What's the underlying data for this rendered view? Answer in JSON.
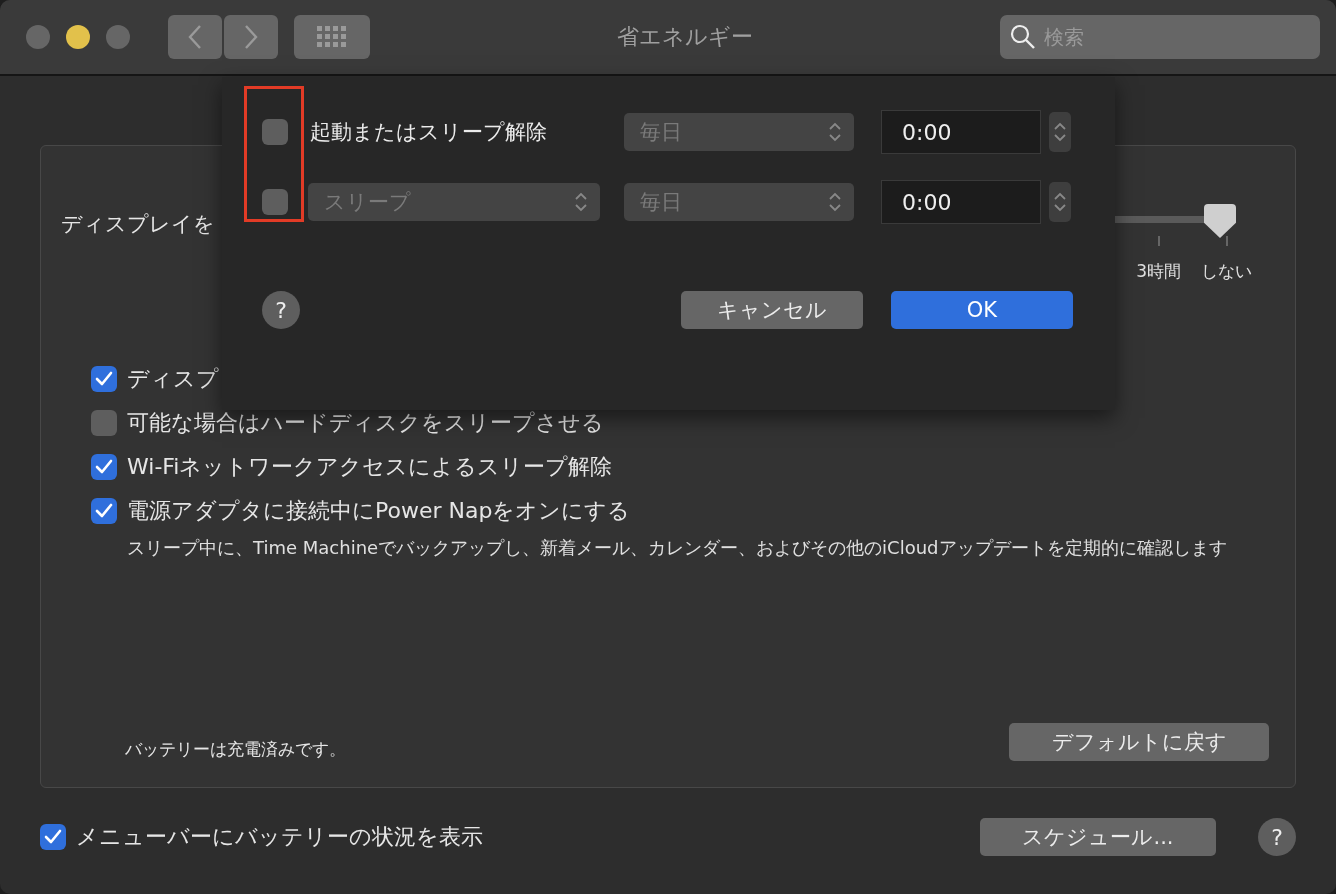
{
  "window": {
    "title": "省エネルギー",
    "search": {
      "placeholder": "検索"
    }
  },
  "panel": {
    "display_sleep": {
      "label": "ディスプレイを",
      "level": 1,
      "ticks": [
        "3時間",
        "しない"
      ]
    },
    "options": [
      {
        "label": "ディスプ",
        "checked": true
      },
      {
        "label": "可能な場合はハードディスクをスリープさせる",
        "checked": false
      },
      {
        "label": "Wi-Fiネットワークアクセスによるスリープ解除",
        "checked": true
      },
      {
        "label": "電源アダプタに接続中にPower Napをオンにする",
        "checked": true,
        "description": "スリープ中に、Time Machineでバックアップし、新着メール、カレンダー、およびその他のiCloudアップデートを定期的に確認します"
      }
    ],
    "battery_status": "バッテリーは充電済みです。",
    "restore_button": "デフォルトに戻す"
  },
  "footer": {
    "show_battery": {
      "label": "メニューバーにバッテリーの状況を表示",
      "checked": true
    },
    "schedule_button": "スケジュール...",
    "help": "?"
  },
  "sheet": {
    "rows": [
      {
        "checked": false,
        "event": {
          "kind": "label",
          "text": "起動またはスリープ解除"
        },
        "repeat": {
          "text": "毎日",
          "disabled": true
        },
        "time": "0:00"
      },
      {
        "checked": false,
        "event": {
          "kind": "popup",
          "text": "スリープ",
          "disabled": true
        },
        "repeat": {
          "text": "毎日",
          "disabled": true
        },
        "time": "0:00"
      }
    ],
    "help": "?",
    "cancel_button": "キャンセル",
    "ok_button": "OK"
  }
}
